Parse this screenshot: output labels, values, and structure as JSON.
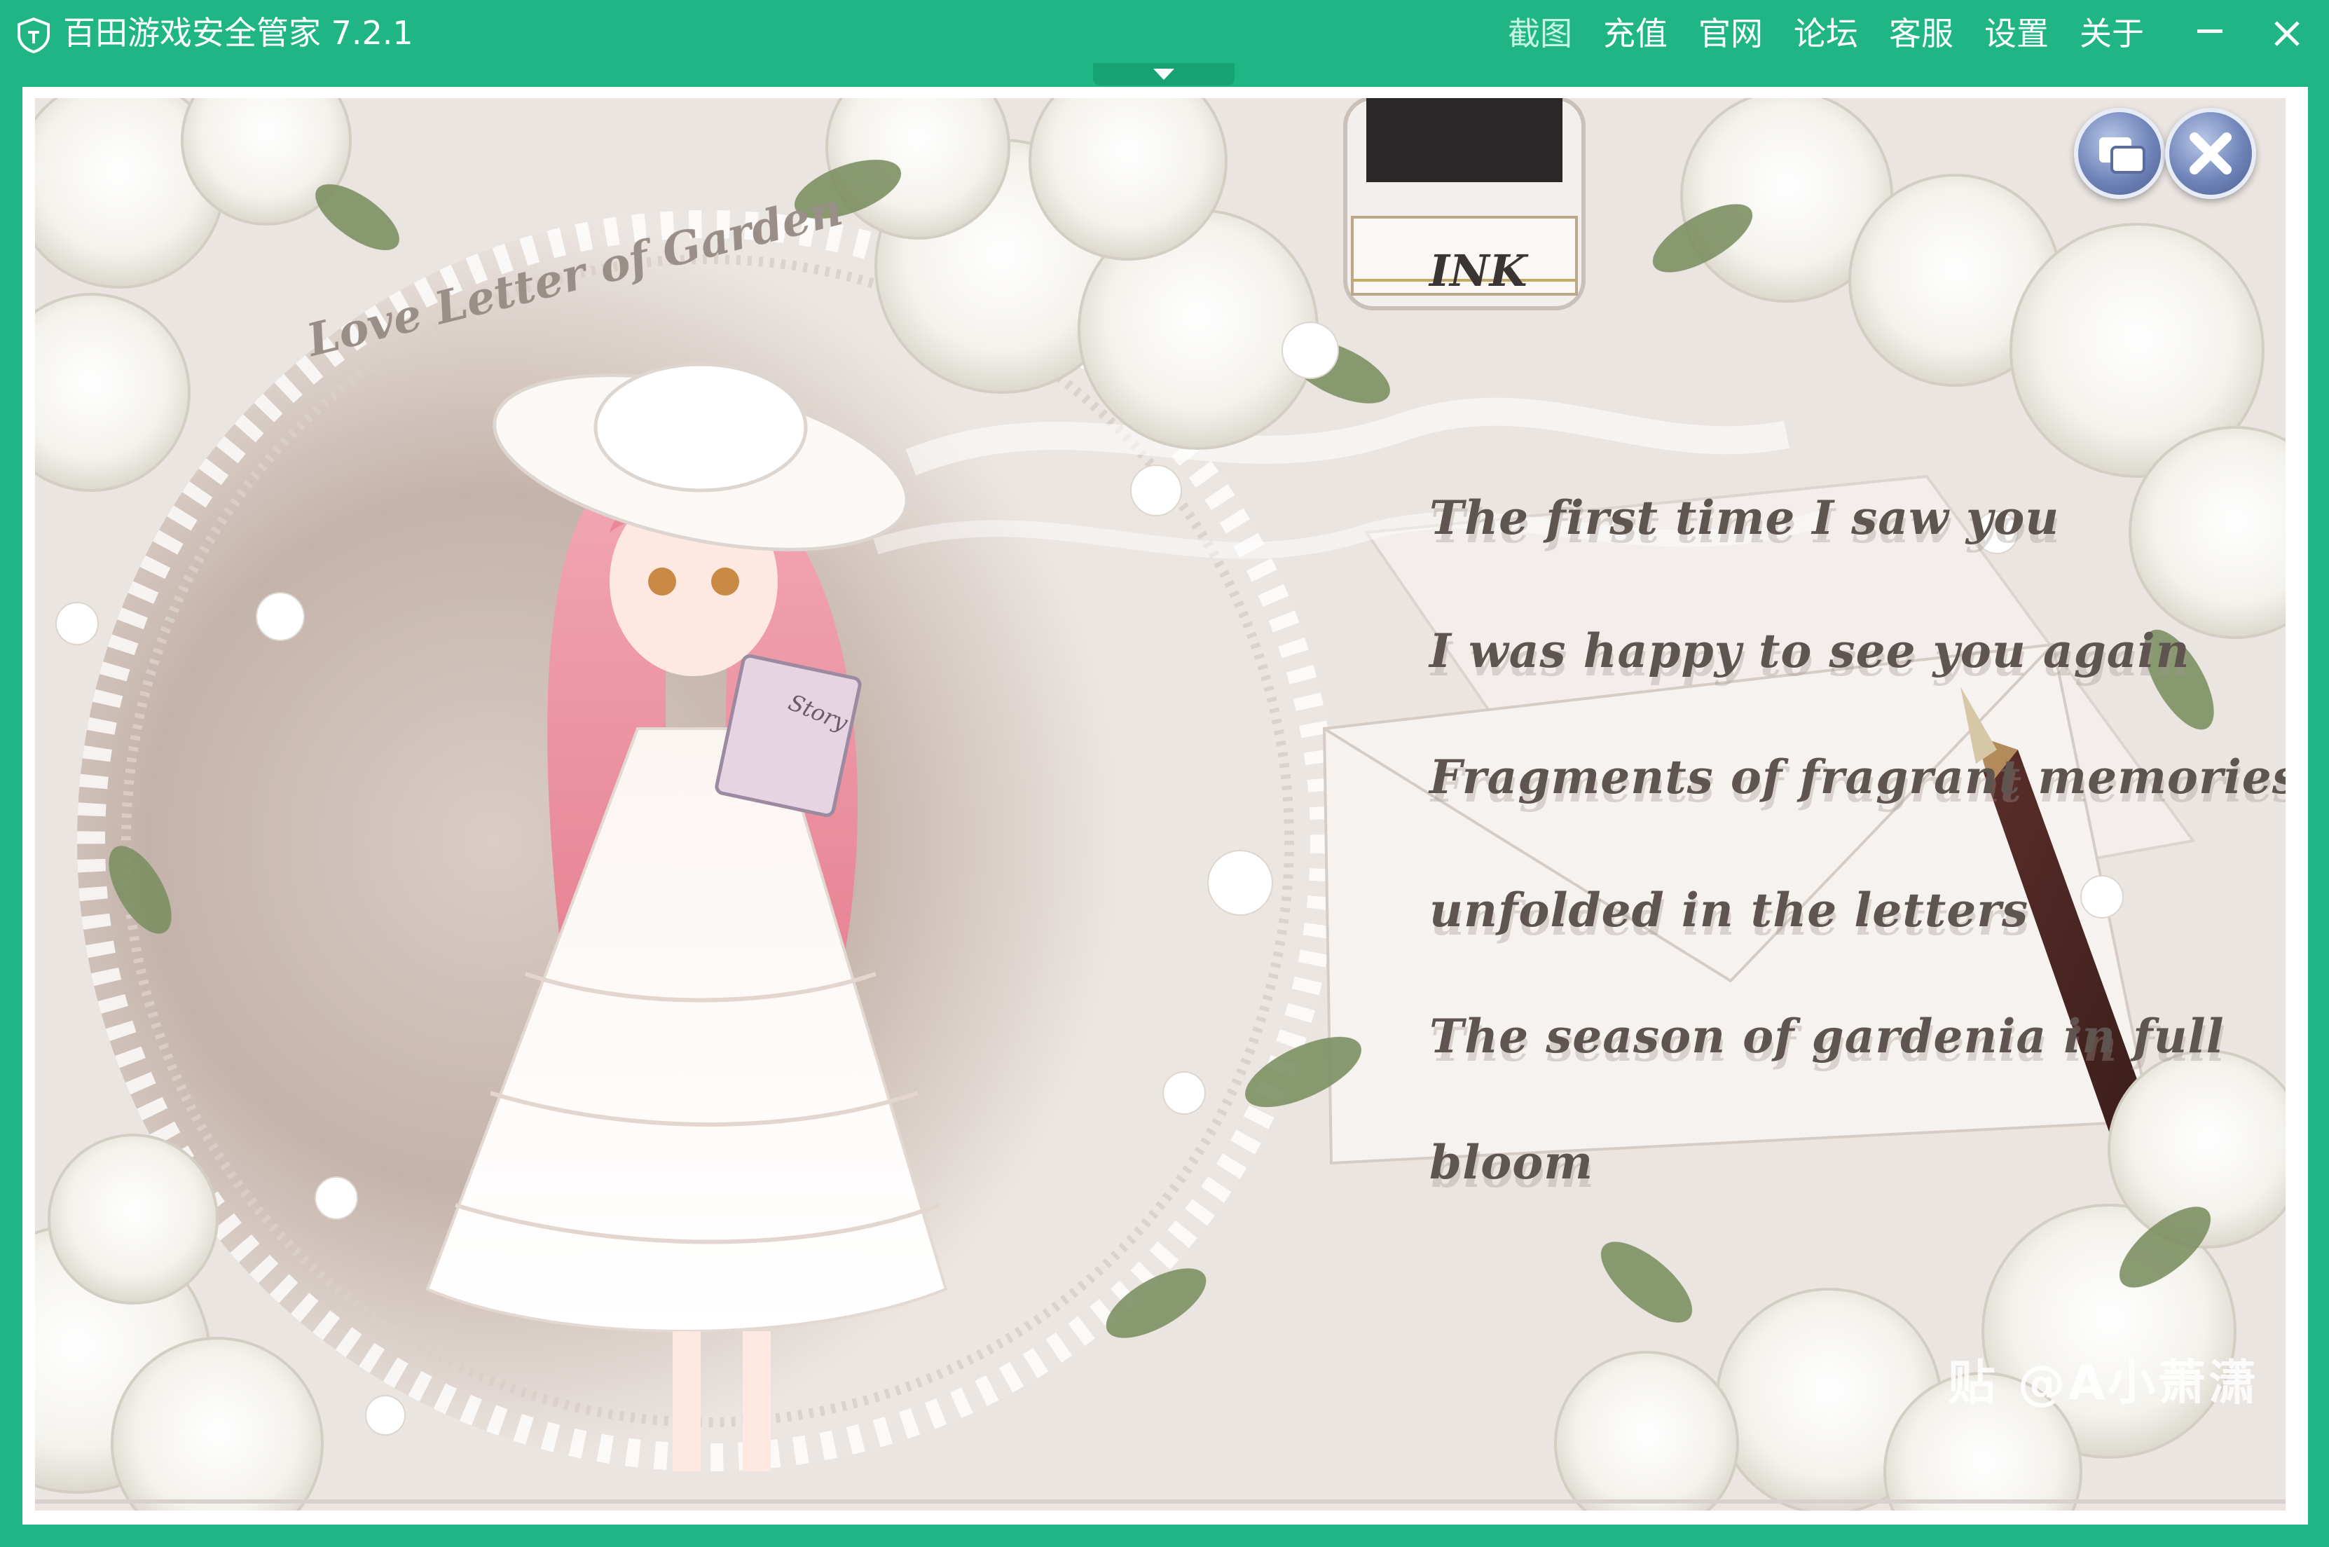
{
  "window": {
    "title": "百田游戏安全管家 7.2.1",
    "logo_icon": "shield-icon"
  },
  "menu": {
    "items": [
      {
        "label": "截图",
        "active": true
      },
      {
        "label": "充值",
        "active": false
      },
      {
        "label": "官网",
        "active": false
      },
      {
        "label": "论坛",
        "active": false
      },
      {
        "label": "客服",
        "active": false
      },
      {
        "label": "设置",
        "active": false
      },
      {
        "label": "关于",
        "active": false
      }
    ],
    "minimize_icon": "minimize-icon",
    "close_icon": "close-icon"
  },
  "game": {
    "script_title": "Love Letter of Garden",
    "ink_label": "INK",
    "book_label": "Story",
    "poem": [
      "The first time I saw you",
      "I was happy to see you again",
      "Fragments of fragrant memories",
      "unfolded in the letters",
      "The season of gardenia in full",
      "bloom"
    ],
    "corner_buttons": [
      "window-toggle-icon",
      "close-icon"
    ]
  },
  "watermark": {
    "text": "贴 @A小萧潇"
  },
  "colors": {
    "titlebar": "#1fb584",
    "active_menu": "#c7f5e3",
    "game_bg": "#ece6e2"
  }
}
